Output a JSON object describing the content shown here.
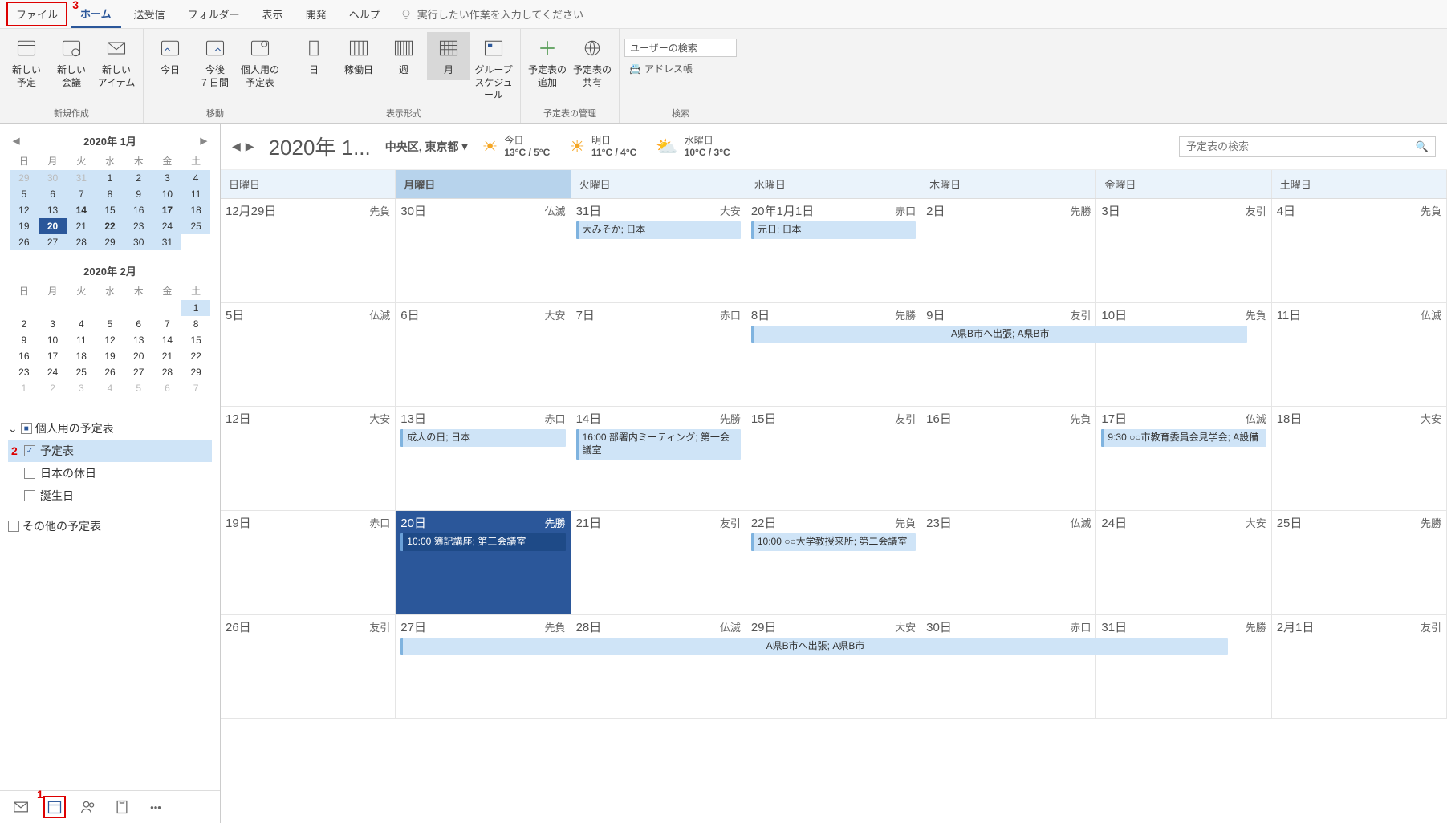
{
  "menubar": {
    "file": "ファイル",
    "home": "ホーム",
    "sendrecv": "送受信",
    "folder": "フォルダー",
    "view": "表示",
    "dev": "開発",
    "help": "ヘルプ",
    "tellme": "実行したい作業を入力してください"
  },
  "annotations": {
    "a1": "1",
    "a2": "2",
    "a3": "3"
  },
  "ribbon": {
    "new_appt": "新しい\n予定",
    "new_meeting": "新しい\n会議",
    "new_items": "新しい\nアイテム",
    "group_new": "新規作成",
    "today_btn": "今日",
    "next7": "今後\n7 日間",
    "personal_cal": "個人用の\n予定表",
    "group_move": "移動",
    "day": "日",
    "workweek": "稼働日",
    "week": "週",
    "month": "月",
    "group_sched": "グループ\nスケジュール",
    "group_format": "表示形式",
    "add_cal": "予定表の\n追加",
    "share_cal": "予定表の\n共有",
    "group_manage": "予定表の管理",
    "search_user": "ユーザーの検索",
    "address_book": "アドレス帳",
    "group_search": "検索"
  },
  "minical1": {
    "title": "2020年 1月",
    "dow": [
      "日",
      "月",
      "火",
      "水",
      "木",
      "金",
      "土"
    ],
    "days": [
      {
        "n": "29",
        "dim": true,
        "range": true
      },
      {
        "n": "30",
        "dim": true,
        "range": true
      },
      {
        "n": "31",
        "dim": true,
        "range": true
      },
      {
        "n": "1",
        "range": true
      },
      {
        "n": "2",
        "range": true
      },
      {
        "n": "3",
        "range": true
      },
      {
        "n": "4",
        "range": true
      },
      {
        "n": "5",
        "range": true
      },
      {
        "n": "6",
        "range": true
      },
      {
        "n": "7",
        "range": true
      },
      {
        "n": "8",
        "range": true
      },
      {
        "n": "9",
        "range": true
      },
      {
        "n": "10",
        "range": true
      },
      {
        "n": "11",
        "range": true
      },
      {
        "n": "12",
        "range": true
      },
      {
        "n": "13",
        "range": true
      },
      {
        "n": "14",
        "range": true,
        "bold": true
      },
      {
        "n": "15",
        "range": true
      },
      {
        "n": "16",
        "range": true
      },
      {
        "n": "17",
        "range": true,
        "bold": true
      },
      {
        "n": "18",
        "range": true
      },
      {
        "n": "19",
        "range": true
      },
      {
        "n": "20",
        "today": true,
        "bold": true
      },
      {
        "n": "21",
        "range": true
      },
      {
        "n": "22",
        "range": true,
        "bold": true
      },
      {
        "n": "23",
        "range": true
      },
      {
        "n": "24",
        "range": true
      },
      {
        "n": "25",
        "range": true
      },
      {
        "n": "26",
        "range": true
      },
      {
        "n": "27",
        "range": true
      },
      {
        "n": "28",
        "range": true
      },
      {
        "n": "29",
        "range": true
      },
      {
        "n": "30",
        "range": true
      },
      {
        "n": "31",
        "range": true
      },
      {
        "n": "",
        "dim": true
      }
    ]
  },
  "minical2": {
    "title": "2020年 2月",
    "dow": [
      "日",
      "月",
      "火",
      "水",
      "木",
      "金",
      "土"
    ],
    "days": [
      {
        "n": ""
      },
      {
        "n": ""
      },
      {
        "n": ""
      },
      {
        "n": ""
      },
      {
        "n": ""
      },
      {
        "n": ""
      },
      {
        "n": "1",
        "range": true
      },
      {
        "n": "2"
      },
      {
        "n": "3"
      },
      {
        "n": "4"
      },
      {
        "n": "5"
      },
      {
        "n": "6"
      },
      {
        "n": "7"
      },
      {
        "n": "8"
      },
      {
        "n": "9"
      },
      {
        "n": "10"
      },
      {
        "n": "11"
      },
      {
        "n": "12"
      },
      {
        "n": "13"
      },
      {
        "n": "14"
      },
      {
        "n": "15"
      },
      {
        "n": "16"
      },
      {
        "n": "17"
      },
      {
        "n": "18"
      },
      {
        "n": "19"
      },
      {
        "n": "20"
      },
      {
        "n": "21"
      },
      {
        "n": "22"
      },
      {
        "n": "23"
      },
      {
        "n": "24"
      },
      {
        "n": "25"
      },
      {
        "n": "26"
      },
      {
        "n": "27"
      },
      {
        "n": "28"
      },
      {
        "n": "29"
      },
      {
        "n": "1",
        "dim": true
      },
      {
        "n": "2",
        "dim": true
      },
      {
        "n": "3",
        "dim": true
      },
      {
        "n": "4",
        "dim": true
      },
      {
        "n": "5",
        "dim": true
      },
      {
        "n": "6",
        "dim": true
      },
      {
        "n": "7",
        "dim": true
      }
    ]
  },
  "caltree": {
    "personal": "個人用の予定表",
    "calendar": "予定表",
    "holidays": "日本の休日",
    "birthdays": "誕生日",
    "other": "その他の予定表"
  },
  "content_header": {
    "title": "2020年 1...",
    "location": "中央区, 東京都",
    "weather": [
      {
        "label": "今日",
        "temp": "13°C / 5°C",
        "icon": "sun"
      },
      {
        "label": "明日",
        "temp": "11°C / 4°C",
        "icon": "sun"
      },
      {
        "label": "水曜日",
        "temp": "10°C / 3°C",
        "icon": "cloud"
      }
    ],
    "search_placeholder": "予定表の検索"
  },
  "dow_headers": [
    "日曜日",
    "月曜日",
    "火曜日",
    "水曜日",
    "木曜日",
    "金曜日",
    "土曜日"
  ],
  "weeks": [
    [
      {
        "d": "12月29日",
        "r": "先負"
      },
      {
        "d": "30日",
        "r": "仏滅"
      },
      {
        "d": "31日",
        "r": "大安",
        "events": [
          {
            "t": "大みそか; 日本"
          }
        ]
      },
      {
        "d": "20年1月1日",
        "r": "赤口",
        "events": [
          {
            "t": "元日; 日本"
          }
        ]
      },
      {
        "d": "2日",
        "r": "先勝"
      },
      {
        "d": "3日",
        "r": "友引"
      },
      {
        "d": "4日",
        "r": "先負"
      }
    ],
    [
      {
        "d": "5日",
        "r": "仏滅"
      },
      {
        "d": "6日",
        "r": "大安"
      },
      {
        "d": "7日",
        "r": "赤口"
      },
      {
        "d": "8日",
        "r": "先勝",
        "span": {
          "t": "A県B市へ出張; A県B市",
          "role": "start",
          "cols": 3,
          "centered": true
        }
      },
      {
        "d": "9日",
        "r": "友引"
      },
      {
        "d": "10日",
        "r": "先負"
      },
      {
        "d": "11日",
        "r": "仏滅"
      }
    ],
    [
      {
        "d": "12日",
        "r": "大安"
      },
      {
        "d": "13日",
        "r": "赤口",
        "events": [
          {
            "t": "成人の日; 日本"
          }
        ]
      },
      {
        "d": "14日",
        "r": "先勝",
        "events": [
          {
            "t": "16:00 部署内ミーティング; 第一会議室"
          }
        ]
      },
      {
        "d": "15日",
        "r": "友引"
      },
      {
        "d": "16日",
        "r": "先負"
      },
      {
        "d": "17日",
        "r": "仏滅",
        "events": [
          {
            "t": "9:30 ○○市教育委員会見学会; A設備"
          }
        ]
      },
      {
        "d": "18日",
        "r": "大安"
      }
    ],
    [
      {
        "d": "19日",
        "r": "赤口"
      },
      {
        "d": "20日",
        "r": "先勝",
        "today": true,
        "events": [
          {
            "t": "10:00 簿記講座; 第三会議室"
          }
        ]
      },
      {
        "d": "21日",
        "r": "友引"
      },
      {
        "d": "22日",
        "r": "先負",
        "events": [
          {
            "t": "10:00 ○○大学教授来所; 第二会議室"
          }
        ]
      },
      {
        "d": "23日",
        "r": "仏滅"
      },
      {
        "d": "24日",
        "r": "大安"
      },
      {
        "d": "25日",
        "r": "先勝"
      }
    ],
    [
      {
        "d": "26日",
        "r": "友引"
      },
      {
        "d": "27日",
        "r": "先負",
        "span": {
          "t": "A県B市へ出張; A県B市",
          "role": "start",
          "cols": 5,
          "centered": true
        }
      },
      {
        "d": "28日",
        "r": "仏滅"
      },
      {
        "d": "29日",
        "r": "大安"
      },
      {
        "d": "30日",
        "r": "赤口"
      },
      {
        "d": "31日",
        "r": "先勝"
      },
      {
        "d": "2月1日",
        "r": "友引"
      }
    ]
  ]
}
